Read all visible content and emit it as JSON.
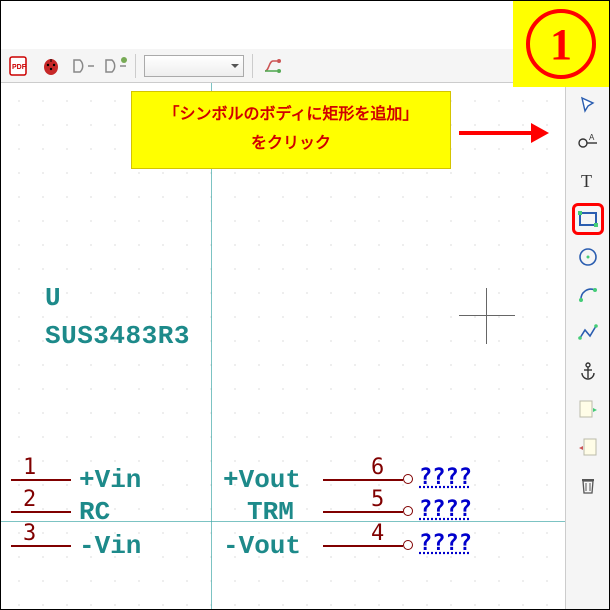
{
  "step_badge": "1",
  "callout": {
    "line1": "「シンボルのボディに矩形を追加」",
    "line2": "をクリック"
  },
  "toolbar_top": {
    "pdf_icon": "PDF",
    "bug_icon": "bug",
    "gate_icon": "gate",
    "gate2_icon": "gate-add",
    "dropdown_value": "",
    "branch_icon": "branch"
  },
  "symbol": {
    "ref": "U",
    "name": "SUS3483R3",
    "pins_left": [
      {
        "num": "1",
        "name": "+Vin"
      },
      {
        "num": "2",
        "name": "RC"
      },
      {
        "num": "3",
        "name": "-Vin"
      }
    ],
    "pins_right": [
      {
        "num": "6",
        "name": "+Vout",
        "net": "????"
      },
      {
        "num": "5",
        "name": "TRM",
        "net": "????"
      },
      {
        "num": "4",
        "name": "-Vout",
        "net": "????"
      }
    ]
  },
  "right_tools": {
    "select": "select",
    "pin": "pin",
    "text": "text",
    "rect": "rectangle",
    "circle": "circle",
    "arc": "arc",
    "polyline": "polyline",
    "anchor": "anchor",
    "import": "import",
    "export": "export",
    "delete": "trash"
  }
}
